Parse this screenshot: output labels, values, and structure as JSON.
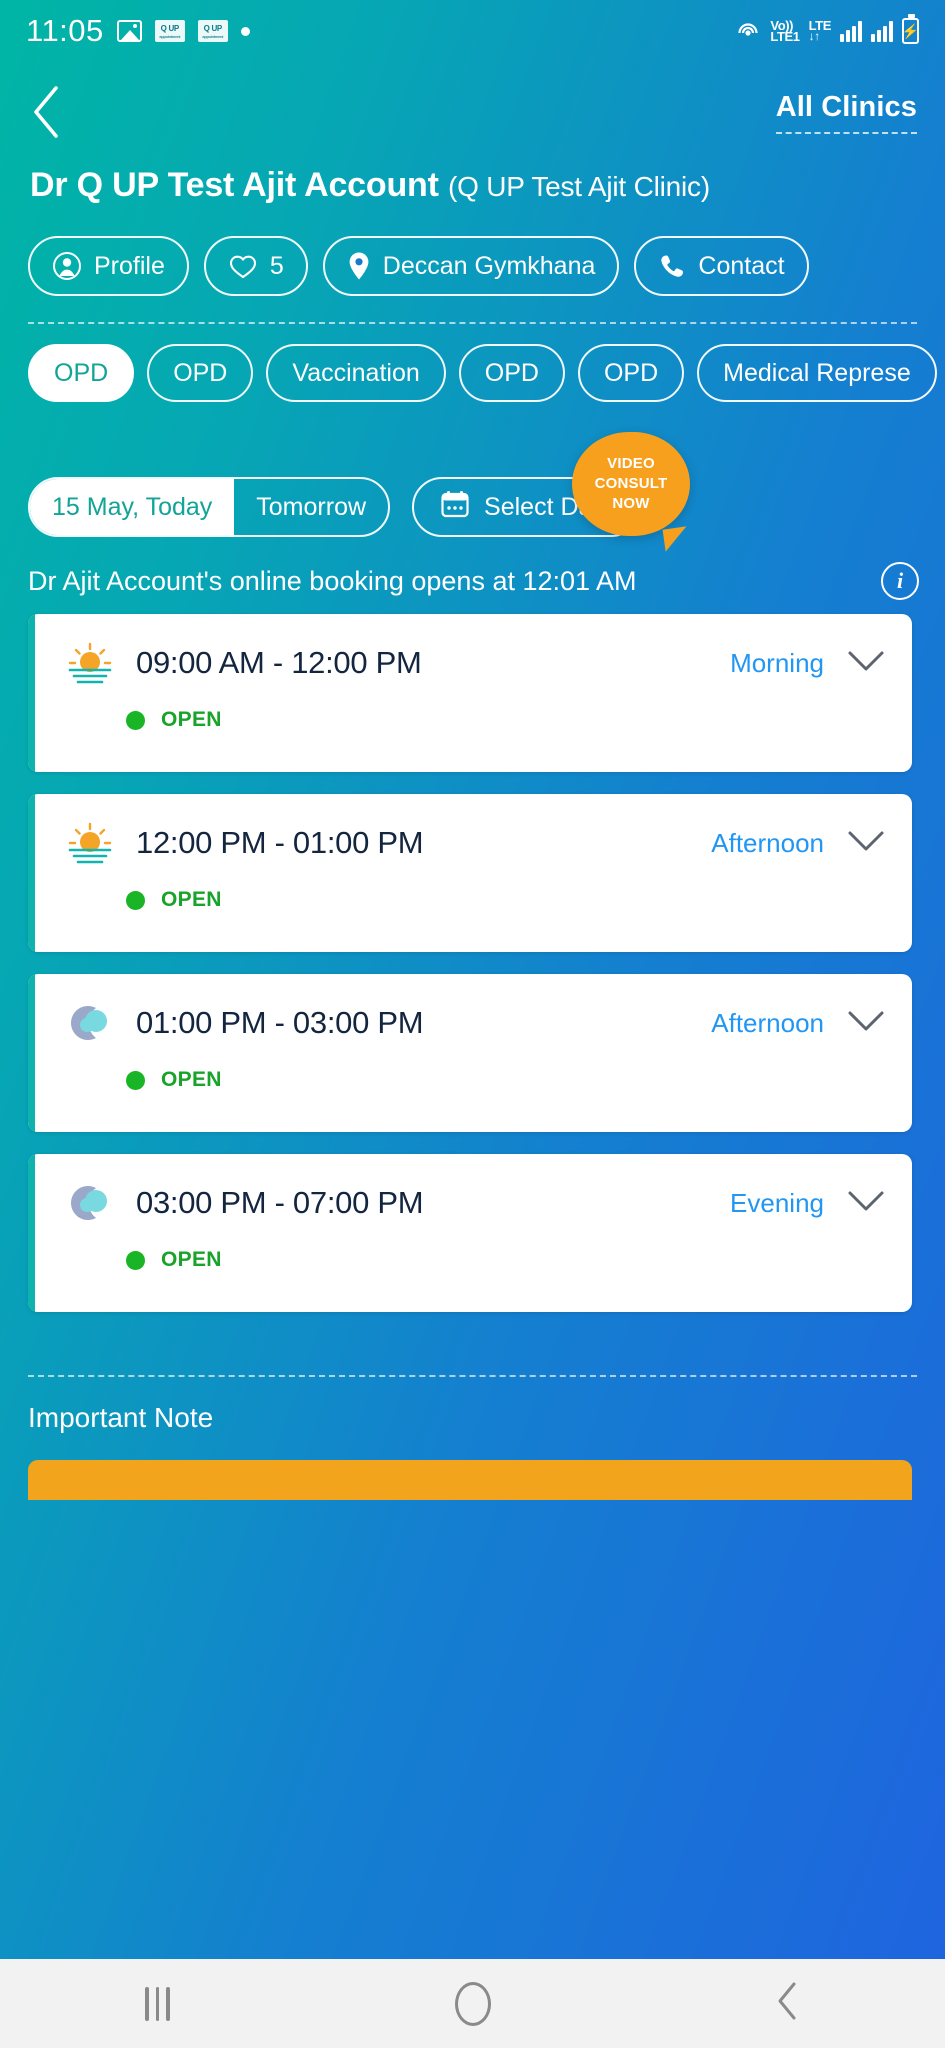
{
  "status_bar": {
    "time": "11:05",
    "icons": [
      "photo-icon",
      "qup-notification-icon",
      "qup-notification-icon",
      "dot-icon"
    ],
    "network": {
      "volte": "Vo))",
      "sim_label": "LTE1",
      "lte": "LTE"
    },
    "right_icons": [
      "cast-icon",
      "volte-icon",
      "signal-bars-icon",
      "signal-bars-icon",
      "battery-charging-icon"
    ]
  },
  "top_nav": {
    "back_label": "back-chevron",
    "all_clinics": "All Clinics"
  },
  "doctor": {
    "name": "Dr Q UP Test Ajit Account",
    "clinic": "(Q UP Test Ajit Clinic)",
    "chips": [
      {
        "icon": "person-icon",
        "label": "Profile"
      },
      {
        "icon": "heart-icon",
        "label": "5"
      },
      {
        "icon": "location-pin-icon",
        "label": "Deccan Gymkhana"
      },
      {
        "icon": "phone-icon",
        "label": "Contact"
      }
    ]
  },
  "service_tabs": [
    {
      "label": "OPD",
      "active": true
    },
    {
      "label": "OPD",
      "active": false
    },
    {
      "label": "Vaccination",
      "active": false
    },
    {
      "label": "OPD",
      "active": false
    },
    {
      "label": "OPD",
      "active": false
    },
    {
      "label": "Medical Represe",
      "active": false
    }
  ],
  "date_selector": {
    "segments": [
      {
        "label": "15 May, Today",
        "active": true
      },
      {
        "label": "Tomorrow",
        "active": false
      }
    ],
    "select_date_label": "Select Date",
    "select_date_icon": "calendar-icon"
  },
  "video_consult": {
    "line1": "VIDEO",
    "line2": "CONSULT",
    "line3": "NOW",
    "color": "#f6a01e"
  },
  "booking_notice": {
    "text": "Dr Ajit Account's online booking opens at 12:01 AM",
    "info_icon": "info-icon"
  },
  "slots": [
    {
      "icon": "sunrise-icon",
      "time": "09:00 AM - 12:00 PM",
      "period": "Morning",
      "status": "OPEN",
      "status_color": "#19a32a",
      "accent": "#0fb3ad"
    },
    {
      "icon": "sunrise-icon",
      "time": "12:00 PM - 01:00 PM",
      "period": "Afternoon",
      "status": "OPEN",
      "status_color": "#19a32a",
      "accent": "#0fb3ad"
    },
    {
      "icon": "moon-cloud-icon",
      "time": "01:00 PM - 03:00 PM",
      "period": "Afternoon",
      "status": "OPEN",
      "status_color": "#19a32a",
      "accent": "#0fb3ad"
    },
    {
      "icon": "moon-cloud-icon",
      "time": "03:00 PM - 07:00 PM",
      "period": "Evening",
      "status": "OPEN",
      "status_color": "#19a32a",
      "accent": "#0fb3ad"
    }
  ],
  "important_note": {
    "title": "Important Note"
  },
  "nav_bar": {
    "recents": "recents-icon",
    "home": "home-icon",
    "back": "back-icon"
  },
  "theme": {
    "gradient_start": "#00b5a5",
    "gradient_end": "#1f63e0",
    "accent_orange": "#f2a41c",
    "link_blue": "#2196f3",
    "card_bg": "#ffffff"
  }
}
